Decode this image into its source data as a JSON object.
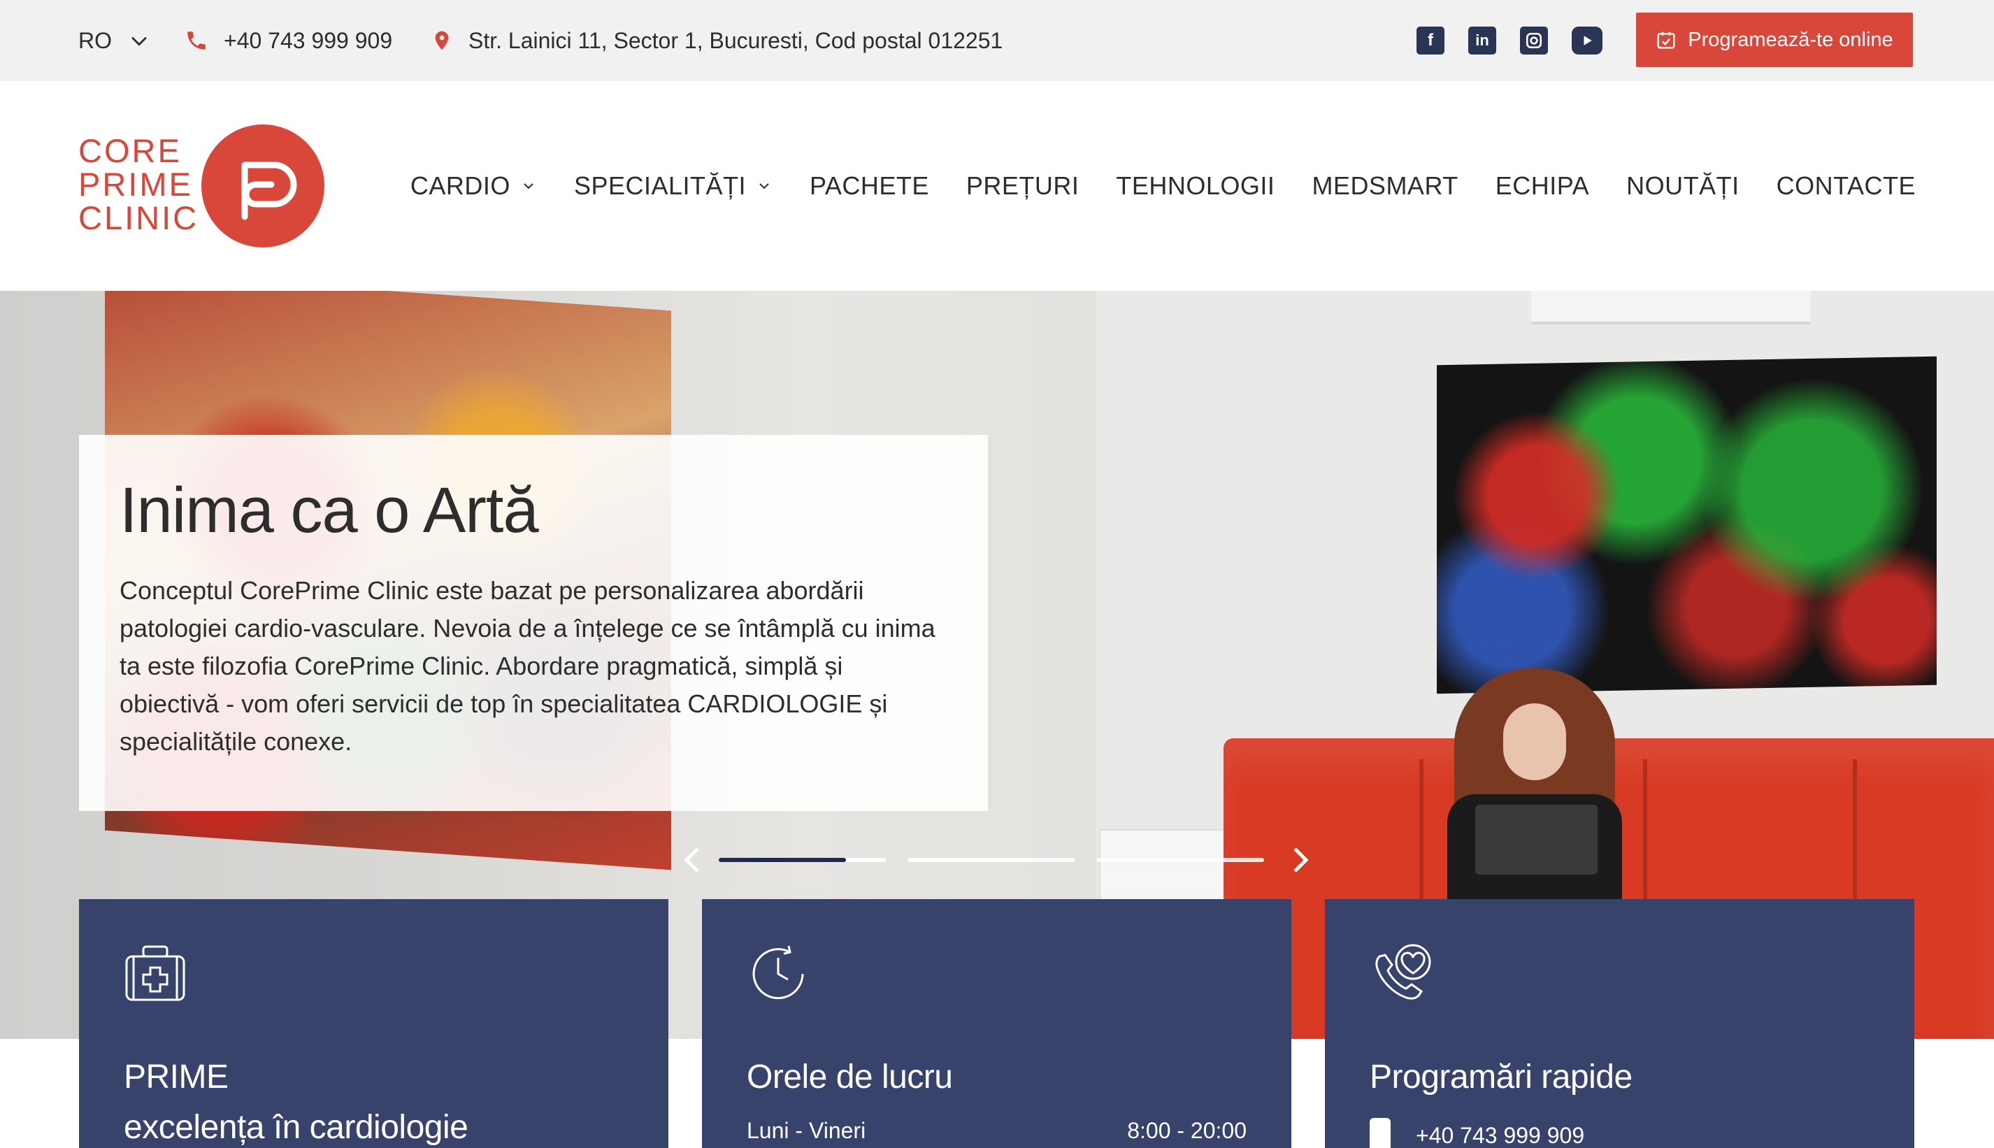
{
  "colors": {
    "accent": "#d9473a",
    "navy": "#37436a",
    "topbar_bg": "#f1f1f1",
    "text": "#2d2d2d"
  },
  "topbar": {
    "language": "RO",
    "phone": "+40 743 999 909",
    "address": "Str. Lainici 11, Sector 1, Bucuresti, Cod postal 012251",
    "socials": [
      "facebook-icon",
      "linkedin-icon",
      "instagram-icon",
      "youtube-icon"
    ],
    "cta_label": "Programează-te online"
  },
  "logo": {
    "line1": "CORE",
    "line2": "PRIME",
    "line3": "CLINIC"
  },
  "nav": {
    "items": [
      "CARDIO",
      "SPECIALITĂȚI",
      "PACHETE",
      "PREȚURI",
      "TEHNOLOGII",
      "MEDSMART",
      "ECHIPA",
      "NOUTĂȚI",
      "CONTACTE"
    ]
  },
  "hero": {
    "title": "Inima ca o Artă",
    "text": "Conceptul CorePrime Clinic este bazat pe personalizarea abordării patologiei cardio-vasculare. Nevoia de a înțelege ce se întâmplă cu inima ta este filozofia CorePrime Clinic. Abordare pragmatică, simplă și obiectivă - vom oferi servicii de top în specialitatea CARDIOLOGIE și specialitățile conexe.",
    "slide_count": 3,
    "active_slide": 1,
    "active_progress": 0.76
  },
  "cards": [
    {
      "icon": "medical-kit-icon",
      "title_line1": "PRIME",
      "title_line2": "excelența în cardiologie"
    },
    {
      "icon": "clock-icon",
      "title": "Orele de lucru",
      "row_label": "Luni - Vineri",
      "row_value": "8:00 - 20:00"
    },
    {
      "icon": "heart-phone-icon",
      "title": "Programări rapide",
      "phone": "+40 743 999 909"
    }
  ]
}
